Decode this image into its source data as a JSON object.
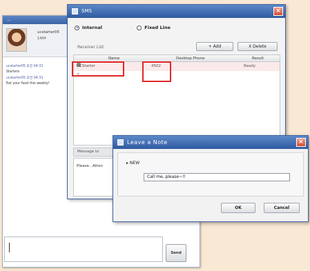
{
  "chat": {
    "title": "...",
    "user_name": "ucstarter05",
    "user_status": "1404",
    "log": [
      {
        "time": "ucstarter05 오전 04:31",
        "text": "Starters"
      },
      {
        "time": "ucstarter05 오전 04:31",
        "text": "Eat your food this weekly!"
      }
    ],
    "send_label": "Send"
  },
  "sms": {
    "title": "SMS",
    "radio_internal": "Internal",
    "radio_fixed": "Fixed Line",
    "receiver_label": "Receiver List",
    "add_label": "+ Add",
    "delete_label": "X Delete",
    "columns": [
      "Name",
      "Desktop Phone",
      "Result"
    ],
    "rows": [
      {
        "name": "UCStarter 2",
        "phone": "4502",
        "result": "Ready"
      }
    ],
    "message_label": "Message to",
    "message_text": "Please...Atten"
  },
  "note": {
    "title": "Leave a Note",
    "label": "NEW",
    "input_value": "Call me, please~!!",
    "ok_label": "OK",
    "cancel_label": "Cancel"
  },
  "colors": {
    "titlebar": "#3b63a5",
    "highlight": "#e32626",
    "background": "#f9e8d4"
  }
}
